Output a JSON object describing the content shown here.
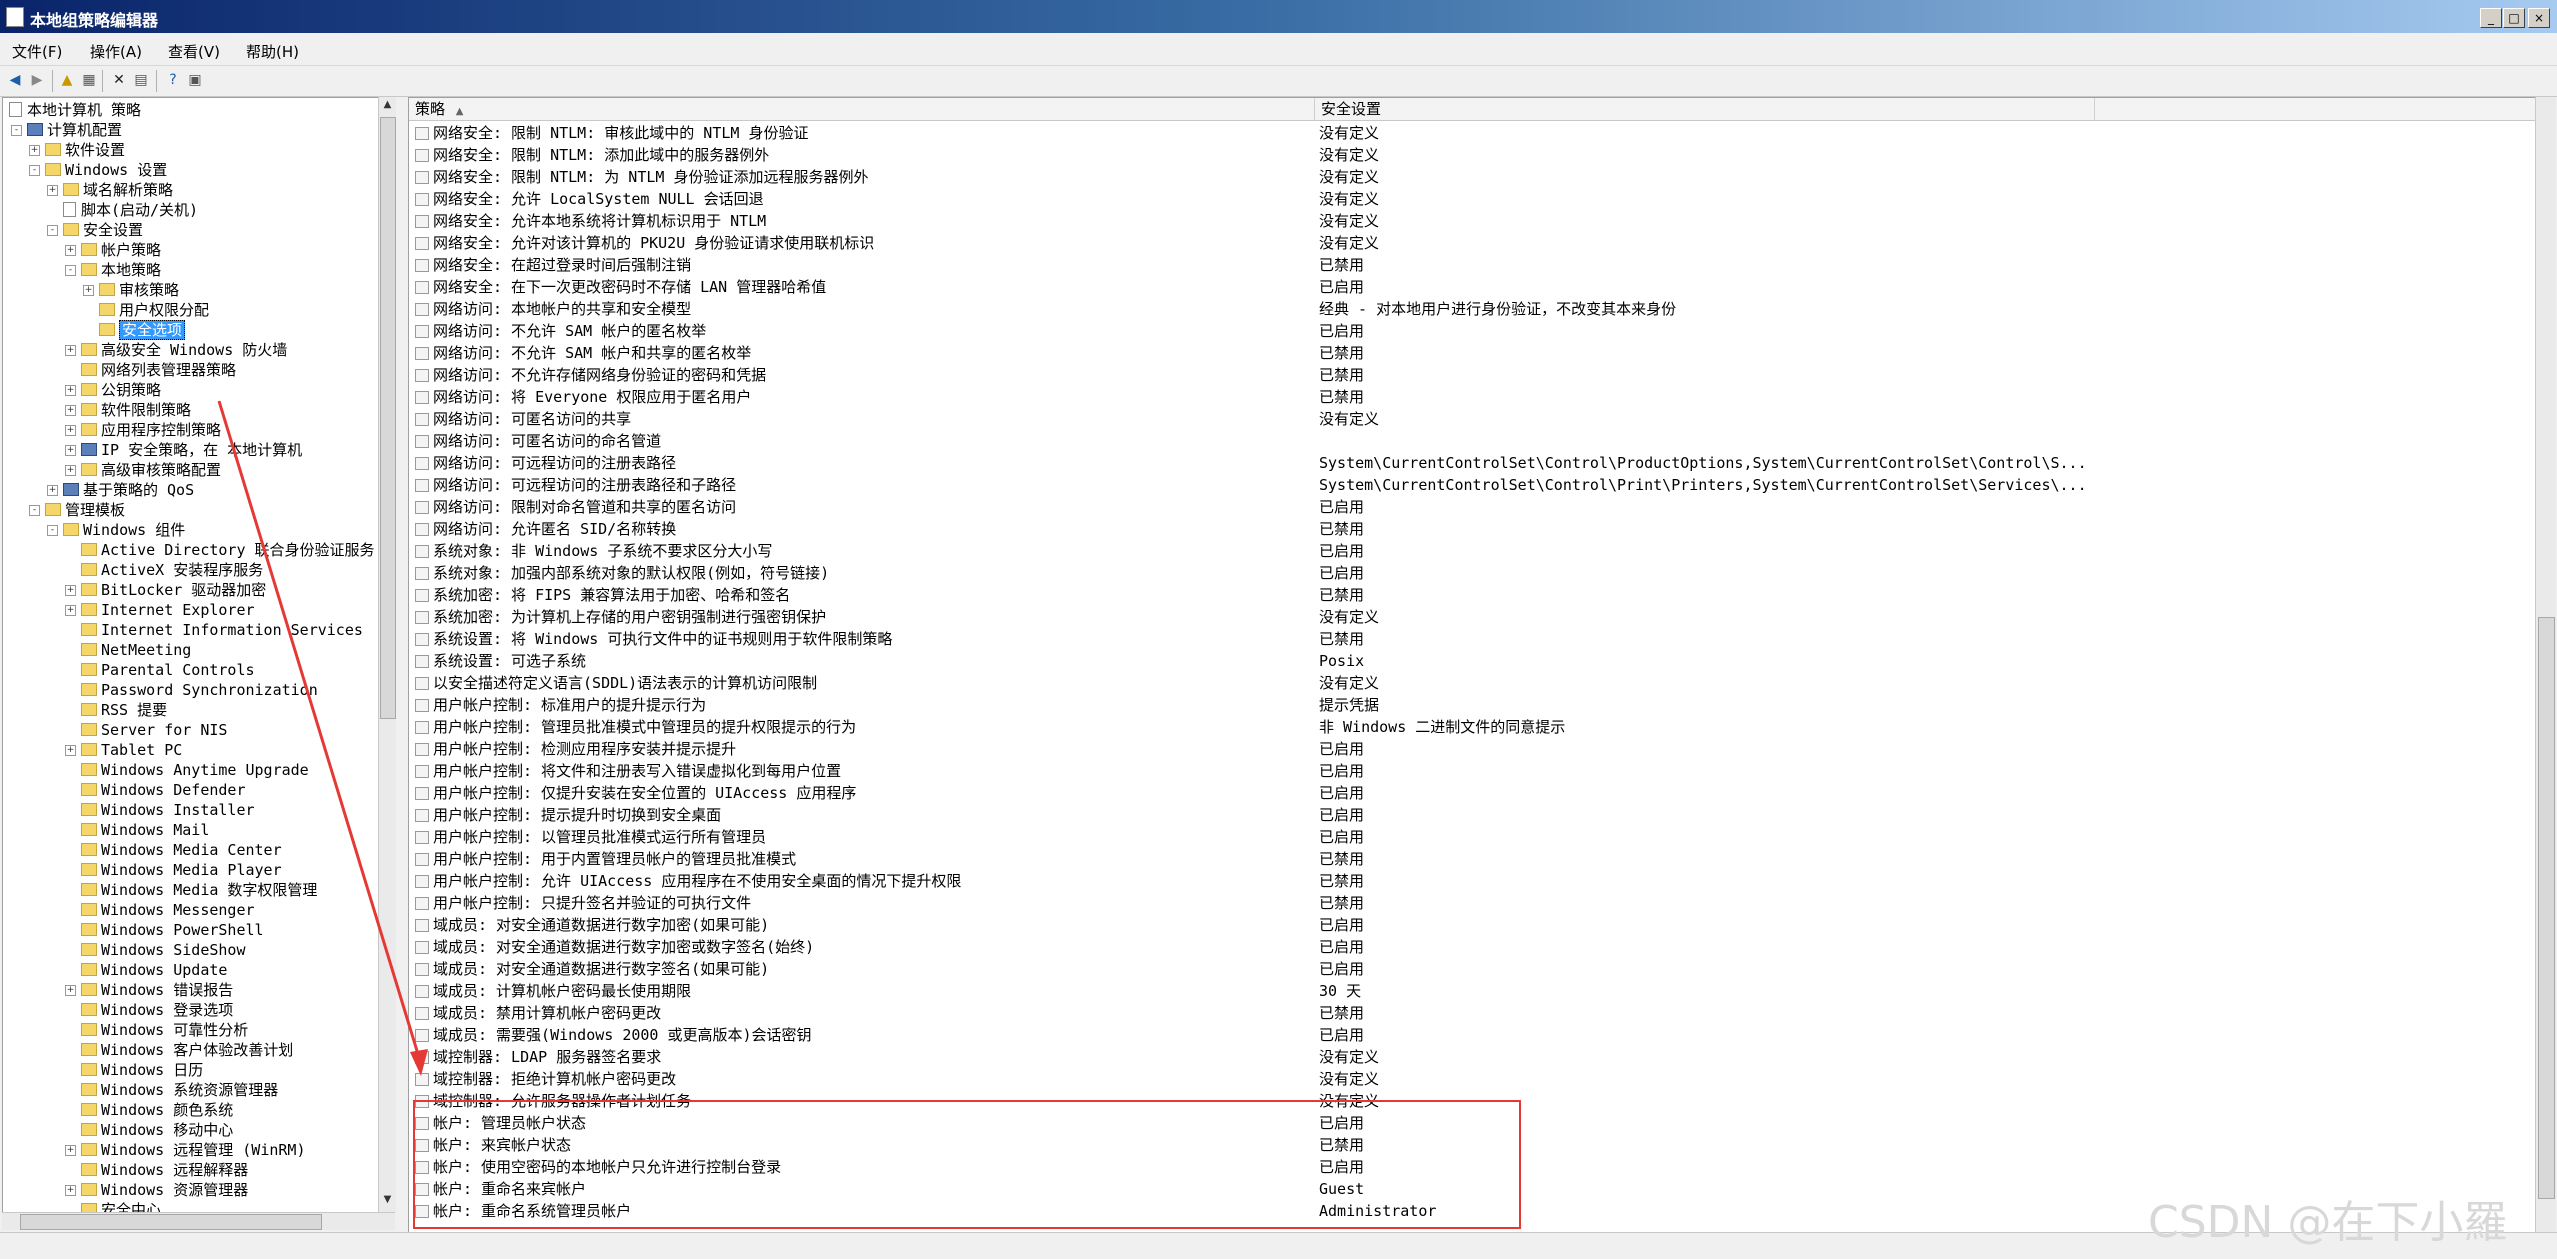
{
  "window": {
    "title": "本地组策略编辑器"
  },
  "menu": [
    "文件(F)",
    "操作(A)",
    "查看(V)",
    "帮助(H)"
  ],
  "toolbar_icons": [
    "back-icon",
    "forward-icon",
    "up-icon",
    "show-hide-tree-icon",
    "delete-icon",
    "properties-icon",
    "help-icon",
    "view-icon"
  ],
  "tree": [
    {
      "label": "本地计算机 策略",
      "indent": 0,
      "icon": "doc",
      "toggle": ""
    },
    {
      "label": "计算机配置",
      "indent": 1,
      "icon": "comp",
      "toggle": "-"
    },
    {
      "label": "软件设置",
      "indent": 2,
      "icon": "fold",
      "toggle": "+"
    },
    {
      "label": "Windows 设置",
      "indent": 2,
      "icon": "fold",
      "toggle": "-"
    },
    {
      "label": "域名解析策略",
      "indent": 3,
      "icon": "fold",
      "toggle": "+"
    },
    {
      "label": "脚本(启动/关机)",
      "indent": 3,
      "icon": "doc",
      "toggle": ""
    },
    {
      "label": "安全设置",
      "indent": 3,
      "icon": "fold",
      "toggle": "-"
    },
    {
      "label": "帐户策略",
      "indent": 4,
      "icon": "fold",
      "toggle": "+"
    },
    {
      "label": "本地策略",
      "indent": 4,
      "icon": "fold",
      "toggle": "-"
    },
    {
      "label": "审核策略",
      "indent": 5,
      "icon": "fold",
      "toggle": "+"
    },
    {
      "label": "用户权限分配",
      "indent": 5,
      "icon": "fold",
      "toggle": ""
    },
    {
      "label": "安全选项",
      "indent": 5,
      "icon": "fold",
      "toggle": "",
      "selected": true
    },
    {
      "label": "高级安全 Windows 防火墙",
      "indent": 4,
      "icon": "fold",
      "toggle": "+"
    },
    {
      "label": "网络列表管理器策略",
      "indent": 4,
      "icon": "fold",
      "toggle": ""
    },
    {
      "label": "公钥策略",
      "indent": 4,
      "icon": "fold",
      "toggle": "+"
    },
    {
      "label": "软件限制策略",
      "indent": 4,
      "icon": "fold",
      "toggle": "+"
    },
    {
      "label": "应用程序控制策略",
      "indent": 4,
      "icon": "fold",
      "toggle": "+"
    },
    {
      "label": "IP 安全策略，在 本地计算机",
      "indent": 4,
      "icon": "comp",
      "toggle": "+"
    },
    {
      "label": "高级审核策略配置",
      "indent": 4,
      "icon": "fold",
      "toggle": "+"
    },
    {
      "label": "基于策略的 QoS",
      "indent": 3,
      "icon": "comp",
      "toggle": "+"
    },
    {
      "label": "管理模板",
      "indent": 2,
      "icon": "fold",
      "toggle": "-"
    },
    {
      "label": "Windows 组件",
      "indent": 3,
      "icon": "fold",
      "toggle": "-"
    },
    {
      "label": "Active Directory 联合身份验证服务",
      "indent": 4,
      "icon": "fold",
      "toggle": ""
    },
    {
      "label": "ActiveX 安装程序服务",
      "indent": 4,
      "icon": "fold",
      "toggle": ""
    },
    {
      "label": "BitLocker 驱动器加密",
      "indent": 4,
      "icon": "fold",
      "toggle": "+"
    },
    {
      "label": "Internet Explorer",
      "indent": 4,
      "icon": "fold",
      "toggle": "+"
    },
    {
      "label": "Internet Information Services",
      "indent": 4,
      "icon": "fold",
      "toggle": ""
    },
    {
      "label": "NetMeeting",
      "indent": 4,
      "icon": "fold",
      "toggle": ""
    },
    {
      "label": "Parental Controls",
      "indent": 4,
      "icon": "fold",
      "toggle": ""
    },
    {
      "label": "Password Synchronization",
      "indent": 4,
      "icon": "fold",
      "toggle": ""
    },
    {
      "label": "RSS 提要",
      "indent": 4,
      "icon": "fold",
      "toggle": ""
    },
    {
      "label": "Server for NIS",
      "indent": 4,
      "icon": "fold",
      "toggle": ""
    },
    {
      "label": "Tablet PC",
      "indent": 4,
      "icon": "fold",
      "toggle": "+"
    },
    {
      "label": "Windows Anytime Upgrade",
      "indent": 4,
      "icon": "fold",
      "toggle": ""
    },
    {
      "label": "Windows Defender",
      "indent": 4,
      "icon": "fold",
      "toggle": ""
    },
    {
      "label": "Windows Installer",
      "indent": 4,
      "icon": "fold",
      "toggle": ""
    },
    {
      "label": "Windows Mail",
      "indent": 4,
      "icon": "fold",
      "toggle": ""
    },
    {
      "label": "Windows Media Center",
      "indent": 4,
      "icon": "fold",
      "toggle": ""
    },
    {
      "label": "Windows Media Player",
      "indent": 4,
      "icon": "fold",
      "toggle": ""
    },
    {
      "label": "Windows Media 数字权限管理",
      "indent": 4,
      "icon": "fold",
      "toggle": ""
    },
    {
      "label": "Windows Messenger",
      "indent": 4,
      "icon": "fold",
      "toggle": ""
    },
    {
      "label": "Windows PowerShell",
      "indent": 4,
      "icon": "fold",
      "toggle": ""
    },
    {
      "label": "Windows SideShow",
      "indent": 4,
      "icon": "fold",
      "toggle": ""
    },
    {
      "label": "Windows Update",
      "indent": 4,
      "icon": "fold",
      "toggle": ""
    },
    {
      "label": "Windows 错误报告",
      "indent": 4,
      "icon": "fold",
      "toggle": "+"
    },
    {
      "label": "Windows 登录选项",
      "indent": 4,
      "icon": "fold",
      "toggle": ""
    },
    {
      "label": "Windows 可靠性分析",
      "indent": 4,
      "icon": "fold",
      "toggle": ""
    },
    {
      "label": "Windows 客户体验改善计划",
      "indent": 4,
      "icon": "fold",
      "toggle": ""
    },
    {
      "label": "Windows 日历",
      "indent": 4,
      "icon": "fold",
      "toggle": ""
    },
    {
      "label": "Windows 系统资源管理器",
      "indent": 4,
      "icon": "fold",
      "toggle": ""
    },
    {
      "label": "Windows 颜色系统",
      "indent": 4,
      "icon": "fold",
      "toggle": ""
    },
    {
      "label": "Windows 移动中心",
      "indent": 4,
      "icon": "fold",
      "toggle": ""
    },
    {
      "label": "Windows 远程管理 (WinRM)",
      "indent": 4,
      "icon": "fold",
      "toggle": "+"
    },
    {
      "label": "Windows 远程解释器",
      "indent": 4,
      "icon": "fold",
      "toggle": ""
    },
    {
      "label": "Windows 资源管理器",
      "indent": 4,
      "icon": "fold",
      "toggle": "+"
    },
    {
      "label": "安全中心",
      "indent": 4,
      "icon": "fold",
      "toggle": ""
    }
  ],
  "list": {
    "col_policy": "策略",
    "col_setting": "安全设置",
    "rows": [
      {
        "policy": "网络安全: 限制 NTLM: 审核此域中的 NTLM 身份验证",
        "setting": "没有定义"
      },
      {
        "policy": "网络安全: 限制 NTLM: 添加此域中的服务器例外",
        "setting": "没有定义"
      },
      {
        "policy": "网络安全: 限制 NTLM: 为 NTLM 身份验证添加远程服务器例外",
        "setting": "没有定义"
      },
      {
        "policy": "网络安全: 允许 LocalSystem NULL 会话回退",
        "setting": "没有定义"
      },
      {
        "policy": "网络安全: 允许本地系统将计算机标识用于 NTLM",
        "setting": "没有定义"
      },
      {
        "policy": "网络安全: 允许对该计算机的 PKU2U 身份验证请求使用联机标识",
        "setting": "没有定义"
      },
      {
        "policy": "网络安全: 在超过登录时间后强制注销",
        "setting": "已禁用"
      },
      {
        "policy": "网络安全: 在下一次更改密码时不存储 LAN 管理器哈希值",
        "setting": "已启用"
      },
      {
        "policy": "网络访问: 本地帐户的共享和安全模型",
        "setting": "经典 - 对本地用户进行身份验证，不改变其本来身份"
      },
      {
        "policy": "网络访问: 不允许 SAM 帐户的匿名枚举",
        "setting": "已启用"
      },
      {
        "policy": "网络访问: 不允许 SAM 帐户和共享的匿名枚举",
        "setting": "已禁用"
      },
      {
        "policy": "网络访问: 不允许存储网络身份验证的密码和凭据",
        "setting": "已禁用"
      },
      {
        "policy": "网络访问: 将 Everyone 权限应用于匿名用户",
        "setting": "已禁用"
      },
      {
        "policy": "网络访问: 可匿名访问的共享",
        "setting": "没有定义"
      },
      {
        "policy": "网络访问: 可匿名访问的命名管道",
        "setting": ""
      },
      {
        "policy": "网络访问: 可远程访问的注册表路径",
        "setting": "System\\CurrentControlSet\\Control\\ProductOptions,System\\CurrentControlSet\\Control\\S..."
      },
      {
        "policy": "网络访问: 可远程访问的注册表路径和子路径",
        "setting": "System\\CurrentControlSet\\Control\\Print\\Printers,System\\CurrentControlSet\\Services\\..."
      },
      {
        "policy": "网络访问: 限制对命名管道和共享的匿名访问",
        "setting": "已启用"
      },
      {
        "policy": "网络访问: 允许匿名 SID/名称转换",
        "setting": "已禁用"
      },
      {
        "policy": "系统对象: 非 Windows 子系统不要求区分大小写",
        "setting": "已启用"
      },
      {
        "policy": "系统对象: 加强内部系统对象的默认权限(例如，符号链接)",
        "setting": "已启用"
      },
      {
        "policy": "系统加密: 将 FIPS 兼容算法用于加密、哈希和签名",
        "setting": "已禁用"
      },
      {
        "policy": "系统加密: 为计算机上存储的用户密钥强制进行强密钥保护",
        "setting": "没有定义"
      },
      {
        "policy": "系统设置: 将 Windows 可执行文件中的证书规则用于软件限制策略",
        "setting": "已禁用"
      },
      {
        "policy": "系统设置: 可选子系统",
        "setting": "Posix"
      },
      {
        "policy": "以安全描述符定义语言(SDDL)语法表示的计算机访问限制",
        "setting": "没有定义"
      },
      {
        "policy": "用户帐户控制: 标准用户的提升提示行为",
        "setting": "提示凭据"
      },
      {
        "policy": "用户帐户控制: 管理员批准模式中管理员的提升权限提示的行为",
        "setting": "非 Windows 二进制文件的同意提示"
      },
      {
        "policy": "用户帐户控制: 检测应用程序安装并提示提升",
        "setting": "已启用"
      },
      {
        "policy": "用户帐户控制: 将文件和注册表写入错误虚拟化到每用户位置",
        "setting": "已启用"
      },
      {
        "policy": "用户帐户控制: 仅提升安装在安全位置的 UIAccess 应用程序",
        "setting": "已启用"
      },
      {
        "policy": "用户帐户控制: 提示提升时切换到安全桌面",
        "setting": "已启用"
      },
      {
        "policy": "用户帐户控制: 以管理员批准模式运行所有管理员",
        "setting": "已启用"
      },
      {
        "policy": "用户帐户控制: 用于内置管理员帐户的管理员批准模式",
        "setting": "已禁用"
      },
      {
        "policy": "用户帐户控制: 允许 UIAccess 应用程序在不使用安全桌面的情况下提升权限",
        "setting": "已禁用"
      },
      {
        "policy": "用户帐户控制: 只提升签名并验证的可执行文件",
        "setting": "已禁用"
      },
      {
        "policy": "域成员: 对安全通道数据进行数字加密(如果可能)",
        "setting": "已启用"
      },
      {
        "policy": "域成员: 对安全通道数据进行数字加密或数字签名(始终)",
        "setting": "已启用"
      },
      {
        "policy": "域成员: 对安全通道数据进行数字签名(如果可能)",
        "setting": "已启用"
      },
      {
        "policy": "域成员: 计算机帐户密码最长使用期限",
        "setting": "30 天"
      },
      {
        "policy": "域成员: 禁用计算机帐户密码更改",
        "setting": "已禁用"
      },
      {
        "policy": "域成员: 需要强(Windows 2000 或更高版本)会话密钥",
        "setting": "已启用"
      },
      {
        "policy": "域控制器: LDAP 服务器签名要求",
        "setting": "没有定义"
      },
      {
        "policy": "域控制器: 拒绝计算机帐户密码更改",
        "setting": "没有定义"
      },
      {
        "policy": "域控制器: 允许服务器操作者计划任务",
        "setting": "没有定义"
      },
      {
        "policy": "帐户: 管理员帐户状态",
        "setting": "已启用"
      },
      {
        "policy": "帐户: 来宾帐户状态",
        "setting": "已禁用"
      },
      {
        "policy": "帐户: 使用空密码的本地帐户只允许进行控制台登录",
        "setting": "已启用"
      },
      {
        "policy": "帐户: 重命名来宾帐户",
        "setting": "Guest"
      },
      {
        "policy": "帐户: 重命名系统管理员帐户",
        "setting": "Administrator"
      }
    ]
  },
  "watermark": "CSDN @在下小羅",
  "annotation_color": "#e53935"
}
